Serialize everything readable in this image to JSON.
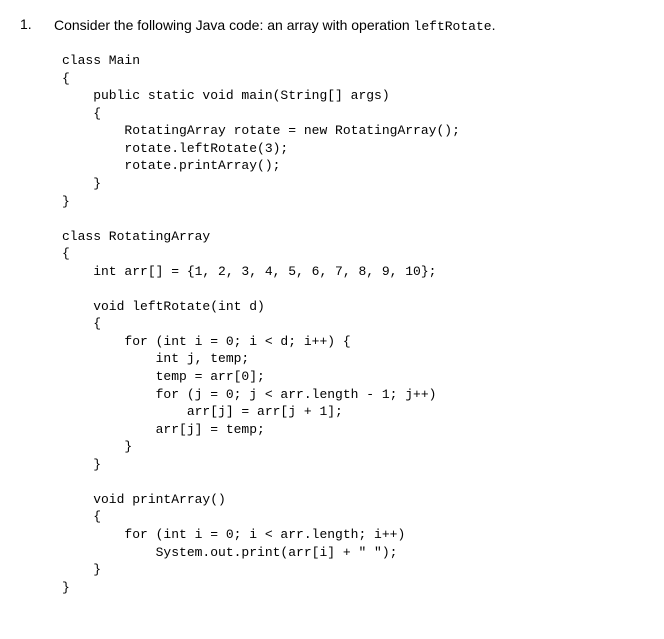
{
  "question": {
    "number": "1.",
    "text_before_code": "Consider the following Java code: an array with operation ",
    "inline_code": "leftRotate",
    "text_after_code": "."
  },
  "code": "class Main\n{\n    public static void main(String[] args)\n    {\n        RotatingArray rotate = new RotatingArray();\n        rotate.leftRotate(3);\n        rotate.printArray();\n    }\n}\n\nclass RotatingArray\n{\n    int arr[] = {1, 2, 3, 4, 5, 6, 7, 8, 9, 10};\n\n    void leftRotate(int d)\n    {\n        for (int i = 0; i < d; i++) {\n            int j, temp;\n            temp = arr[0];\n            for (j = 0; j < arr.length - 1; j++)\n                arr[j] = arr[j + 1];\n            arr[j] = temp;\n        }\n    }\n\n    void printArray()\n    {\n        for (int i = 0; i < arr.length; i++)\n            System.out.print(arr[i] + \" \");\n    }\n}"
}
